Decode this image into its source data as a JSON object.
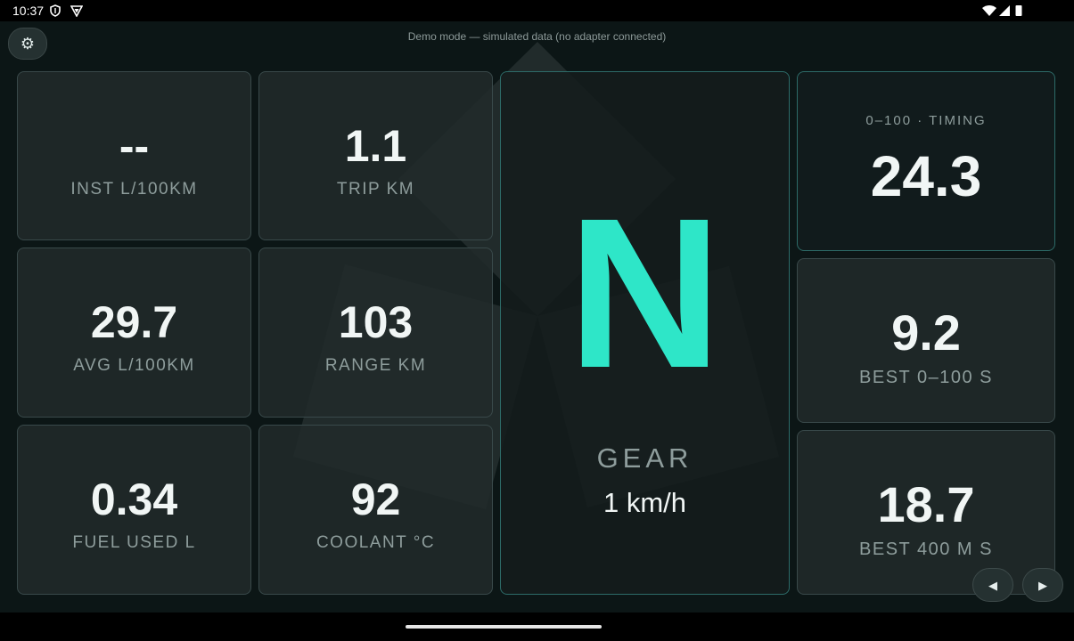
{
  "status_bar": {
    "time": "10:37",
    "icons": [
      "shield-icon",
      "vpn-icon",
      "wifi-icon",
      "cell-signal-icon",
      "battery-icon"
    ]
  },
  "header": {
    "settings_icon": "gear-icon",
    "settings_glyph": "⚙",
    "demo_banner": "Demo mode — simulated data (no adapter connected)"
  },
  "tiles": [
    {
      "value": "--",
      "label": "INST L/100KM"
    },
    {
      "value": "1.1",
      "label": "TRIP KM"
    },
    {
      "value": "29.7",
      "label": "AVG L/100KM"
    },
    {
      "value": "103",
      "label": "RANGE KM"
    },
    {
      "value": "0.34",
      "label": "FUEL USED L"
    },
    {
      "value": "92",
      "label": "COOLANT °C"
    }
  ],
  "gear": {
    "value": "N",
    "label": "GEAR",
    "speed": "1 km/h"
  },
  "timing": {
    "title": "0–100 · TIMING",
    "value": "24.3"
  },
  "best": [
    {
      "value": "9.2",
      "label": "BEST 0–100 S"
    },
    {
      "value": "18.7",
      "label": "BEST 400 M S"
    }
  ],
  "nav": {
    "prev_glyph": "◀",
    "next_glyph": "▶"
  },
  "colors": {
    "accent": "#2ee6c8",
    "background": "#0c1616",
    "tile": "#212a2a",
    "border_accent": "#2d6b68",
    "label": "#8e9d9c"
  }
}
